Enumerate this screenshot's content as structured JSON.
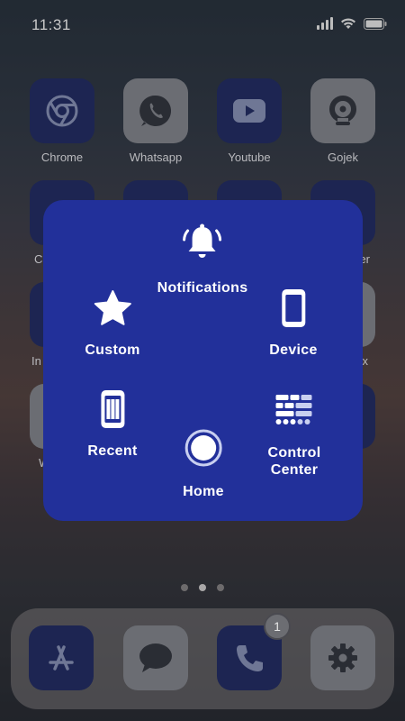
{
  "status_bar": {
    "time": "11:31"
  },
  "apps": [
    {
      "label": "Chrome",
      "icon": "chrome-icon"
    },
    {
      "label": "Whatsapp",
      "icon": "whatsapp-icon"
    },
    {
      "label": "Youtube",
      "icon": "youtube-icon"
    },
    {
      "label": "Gojek",
      "icon": "gojek-icon"
    }
  ],
  "partially_hidden_labels": {
    "row2_left": "C",
    "row2_right": "er",
    "row3_left": "In",
    "row3_right": "x",
    "row4_left": "W"
  },
  "pages": {
    "count": 3,
    "active": 2
  },
  "dock": [
    {
      "icon": "app-store-icon"
    },
    {
      "icon": "messages-icon"
    },
    {
      "icon": "phone-icon",
      "badge": "1"
    },
    {
      "icon": "settings-icon"
    }
  ],
  "assistive_menu": {
    "notifications": "Notifications",
    "custom": "Custom",
    "device": "Device",
    "recent": "Recent",
    "home": "Home",
    "control_center": "Control\nCenter"
  },
  "colors": {
    "panel": "#22309a",
    "tile_navy": "#1d2552",
    "tile_gray": "#6b6d73"
  }
}
